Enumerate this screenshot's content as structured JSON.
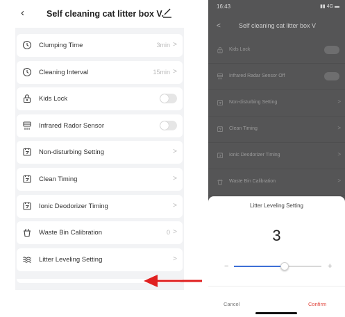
{
  "left": {
    "header": {
      "back_icon": "chevron-left-icon",
      "title": "Self cleaning cat litter box V...",
      "edit_icon": "pencil-edit-icon"
    },
    "rows": [
      {
        "label": "Clumping Time",
        "icon": "clock-icon",
        "value": "3min",
        "control": "chevron"
      },
      {
        "label": "Cleaning Interval",
        "icon": "clock-icon",
        "value": "15min",
        "control": "chevron"
      },
      {
        "label": "Kids Lock",
        "icon": "lock-icon",
        "value": "",
        "control": "toggle",
        "state": "off"
      },
      {
        "label": "Infrared Rador Sensor",
        "icon": "sensor-icon",
        "value": "",
        "control": "toggle",
        "state": "off"
      },
      {
        "label": "Non-disturbing Setting",
        "icon": "calendar-icon",
        "value": "",
        "control": "chevron"
      },
      {
        "label": "Clean Timing",
        "icon": "calendar-icon",
        "value": "",
        "control": "chevron"
      },
      {
        "label": "Ionic Deodorizer Timing",
        "icon": "calendar-icon",
        "value": "",
        "control": "chevron"
      },
      {
        "label": "Waste Bin Calibration",
        "icon": "bin-icon",
        "value": "0",
        "control": "chevron"
      },
      {
        "label": "Litter Leveling Setting",
        "icon": "waves-icon",
        "value": "",
        "control": "chevron"
      }
    ],
    "chevron": ">"
  },
  "arrow": {
    "color": "#e02020"
  },
  "right": {
    "status": {
      "time": "16:43",
      "signal": "▮▮ 4G ▬"
    },
    "header": {
      "back": "<",
      "title": "Self cleaning cat litter box V"
    },
    "rows": [
      {
        "label": "Kids Lock",
        "icon": "lock-icon",
        "control": "toggle"
      },
      {
        "label": "Infrared Radar Sensor Off",
        "icon": "sensor-icon",
        "control": "toggle"
      },
      {
        "label": "Non-disturbing Setting",
        "icon": "calendar-icon",
        "control": "chevron"
      },
      {
        "label": "Clean Timing",
        "icon": "calendar-icon",
        "control": "chevron"
      },
      {
        "label": "Ionic Deodorizer Timing",
        "icon": "calendar-icon",
        "control": "chevron"
      },
      {
        "label": "Waste Bin Calibration",
        "icon": "bin-icon",
        "control": "chevron"
      }
    ],
    "sheet": {
      "title": "Litter Leveling Setting",
      "value": "3",
      "minus": "−",
      "plus": "+",
      "slider_fraction": 0.58,
      "accent": "#3d6fd6",
      "cancel": "Cancel",
      "confirm": "Confirm",
      "confirm_color": "#e0453c"
    }
  }
}
